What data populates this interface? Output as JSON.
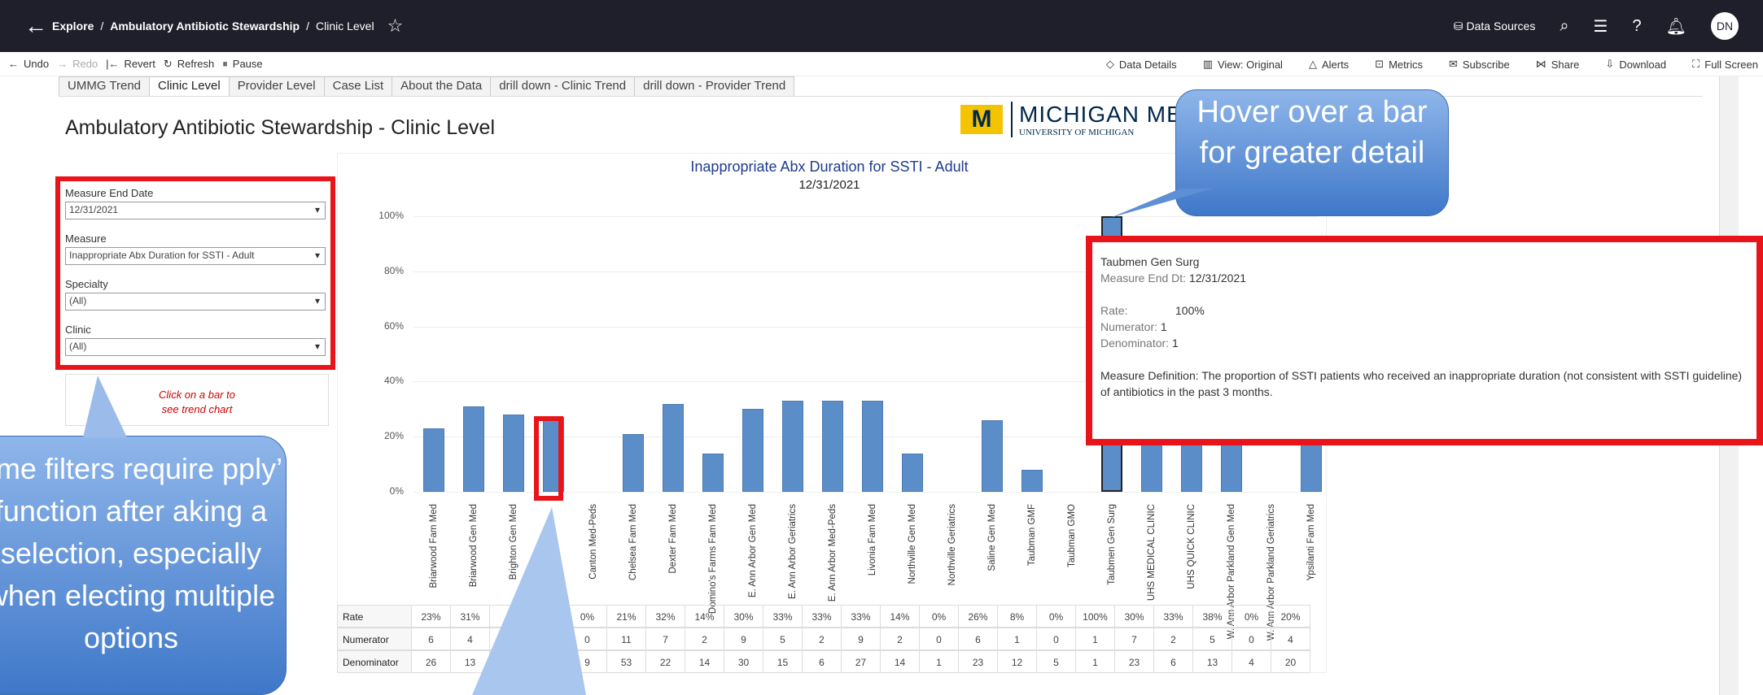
{
  "header": {
    "back_icon": "arrow-left-icon",
    "breadcrumb": [
      "Explore",
      "Ambulatory Antibiotic Stewardship",
      "Clinic Level"
    ],
    "separator": "/",
    "right": {
      "data_sources": "Data Sources",
      "avatar_initials": "DN"
    }
  },
  "toolbar": {
    "left": [
      "Undo",
      "Redo",
      "Revert",
      "Refresh",
      "Pause"
    ],
    "right": [
      "Data Details",
      "View: Original",
      "Alerts",
      "Metrics",
      "Subscribe",
      "Share",
      "Download",
      "Full Screen"
    ]
  },
  "tabs": [
    "UMMG Trend",
    "Clinic Level",
    "Provider Level",
    "Case List",
    "About the Data",
    "drill down - Clinic Trend",
    "drill down - Provider Trend"
  ],
  "active_tab": "Clinic Level",
  "dashboard": {
    "title": "Ambulatory Antibiotic Stewardship - Clinic Level",
    "logo": {
      "mark": "M",
      "line1": "MICHIGAN MEDICIN",
      "line2": "UNIVERSITY OF MICHIGAN"
    }
  },
  "filters": [
    {
      "label": "Measure End Date",
      "value": "12/31/2021"
    },
    {
      "label": "Measure",
      "value": "Inappropriate Abx Duration for SSTI - Adult"
    },
    {
      "label": "Specialty",
      "value": "(All)"
    },
    {
      "label": "Clinic",
      "value": "(All)"
    }
  ],
  "hint": {
    "line1": "Click on a bar to",
    "line2": "see trend chart"
  },
  "chart_data": {
    "type": "bar",
    "title": "Inappropriate Abx Duration for SSTI - Adult",
    "subtitle": "12/31/2021",
    "ylim": [
      0,
      100
    ],
    "yticks": [
      "100%",
      "80%",
      "60%",
      "40%",
      "20%",
      "0%"
    ],
    "categories": [
      "Briarwood Fam Med",
      "Briarwood Gen Med",
      "Brighton Gen Med",
      "",
      "Canton Med-Peds",
      "Chelsea Fam Med",
      "Dexter Fam Med",
      "Domino's Farms Fam Med",
      "E. Ann Arbor Gen Med",
      "E. Ann Arbor Geriatrics",
      "E. Ann Arbor Med-Peds",
      "Livonia Fam Med",
      "Northville Gen Med",
      "Northville Geriatrics",
      "Saline Gen Med",
      "Taubman GMF",
      "Taubman GMO",
      "Taubmen Gen Surg",
      "UHS MEDICAL CLINIC",
      "UHS QUICK CLINIC",
      "W. Ann Arbor Parkland Gen Med",
      "W. Ann Arbor Parkland Geriatrics",
      "Ypsilanti Fam Med"
    ],
    "values": [
      23,
      31,
      28,
      27,
      0,
      21,
      32,
      14,
      30,
      33,
      33,
      33,
      14,
      0,
      26,
      8,
      0,
      100,
      30,
      33,
      38,
      0,
      20
    ],
    "table": {
      "row_labels": [
        "Rate",
        "Numerator",
        "Denominator"
      ],
      "rate": [
        "23%",
        "31%",
        "",
        "",
        "0%",
        "21%",
        "32%",
        "14%",
        "30%",
        "33%",
        "33%",
        "33%",
        "14%",
        "0%",
        "26%",
        "8%",
        "0%",
        "100%",
        "30%",
        "33%",
        "38%",
        "0%",
        "20%"
      ],
      "numerator": [
        "6",
        "4",
        "",
        "",
        "0",
        "11",
        "7",
        "2",
        "9",
        "5",
        "2",
        "9",
        "2",
        "0",
        "6",
        "1",
        "0",
        "1",
        "7",
        "2",
        "5",
        "0",
        "4"
      ],
      "denominator": [
        "26",
        "13",
        "",
        "",
        "9",
        "53",
        "22",
        "14",
        "30",
        "15",
        "6",
        "27",
        "14",
        "1",
        "23",
        "12",
        "5",
        "1",
        "23",
        "6",
        "13",
        "4",
        "20"
      ]
    }
  },
  "tooltip": {
    "clinic": "Taubmen Gen Surg",
    "end_label": "Measure End Dt:",
    "end_value": "12/31/2021",
    "rate_label": "Rate:",
    "rate_value": "100%",
    "num_label": "Numerator:",
    "num_value": "1",
    "den_label": "Denominator:",
    "den_value": "1",
    "definition": "Measure Definition: The proportion of SSTI patients who received an inappropriate duration (not consistent with SSTI guideline) of antibiotics in the past 3 months."
  },
  "callouts": {
    "hover": "Hover over a bar for greater detail",
    "filters": "ome filters require pply’ function after aking a selection, especially when electing multiple options"
  },
  "colors": {
    "bar": "#5b8ec9",
    "highlight": "#e8141a",
    "topbar": "#1f1f2b"
  }
}
